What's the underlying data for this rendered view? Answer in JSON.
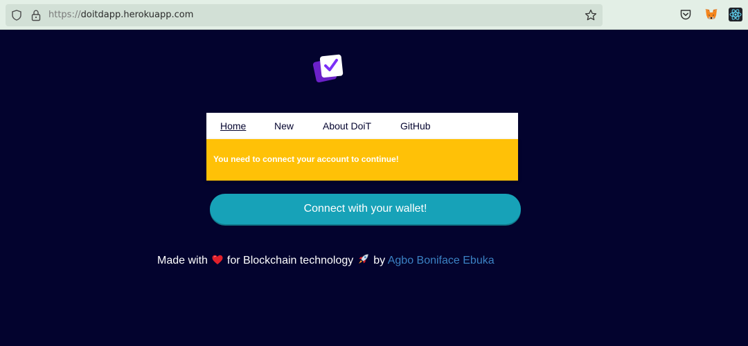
{
  "browser": {
    "url_protocol": "https://",
    "url_host": "doitdapp.herokuapp.com"
  },
  "nav": {
    "items": [
      {
        "label": "Home",
        "active": true
      },
      {
        "label": "New"
      },
      {
        "label": "About DoiT"
      },
      {
        "label": "GitHub"
      }
    ]
  },
  "alert": {
    "message": "You need to connect your account to continue!"
  },
  "connect_button": {
    "label": "Connect with your wallet!"
  },
  "footer": {
    "made_with": "Made with",
    "for_text": "for Blockchain technology",
    "by_text": "by",
    "author": "Agbo Boniface Ebuka"
  },
  "colors": {
    "page_background": "#03032e",
    "alert_background": "#ffc107",
    "button_background": "#17a2b8",
    "author_link": "#3b82c4"
  },
  "icons": [
    "shield-icon",
    "lock-icon",
    "star-icon",
    "pocket-icon",
    "metamask-fox-icon",
    "react-devtools-icon",
    "doit-logo-icon",
    "heart-icon",
    "rocket-icon"
  ]
}
